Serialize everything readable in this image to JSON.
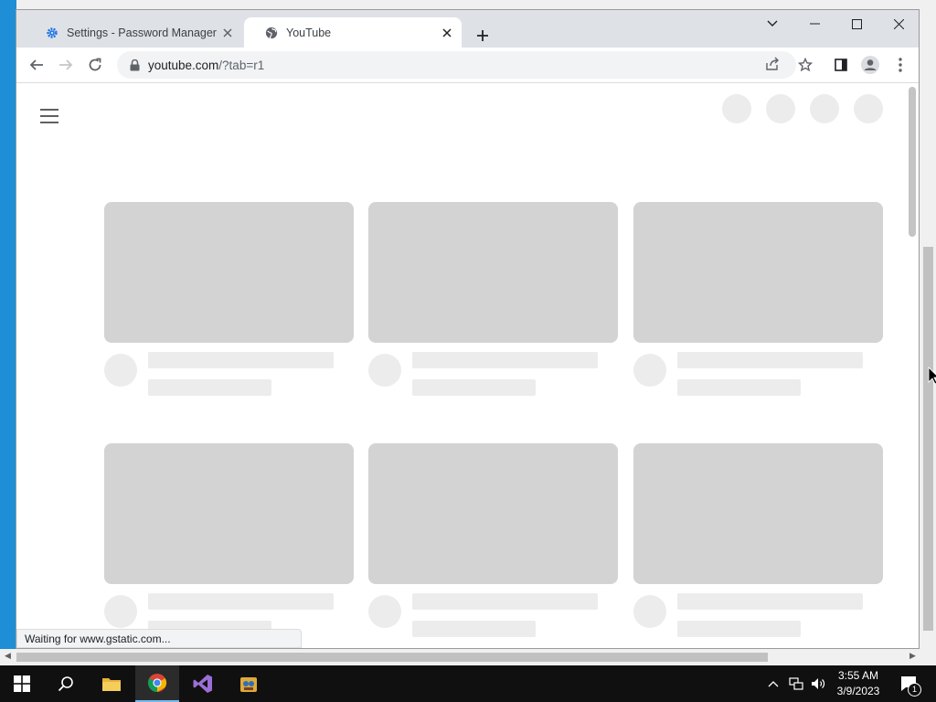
{
  "browser": {
    "tabs": [
      {
        "title": "Settings - Password Manager",
        "icon": "gear-icon",
        "active": false
      },
      {
        "title": "YouTube",
        "icon": "globe-icon",
        "active": true
      }
    ],
    "url_host": "youtube.com",
    "url_path": "/?tab=r1"
  },
  "status_text": "Waiting for www.gstatic.com...",
  "taskbar": {
    "time": "3:55 AM",
    "date": "3/9/2023",
    "notification_count": "1"
  },
  "colors": {
    "accent": "#1a73e8",
    "skeleton": "#d3d3d3",
    "skeleton_light": "#ececec",
    "desktop_blue": "#1e8fd6"
  }
}
